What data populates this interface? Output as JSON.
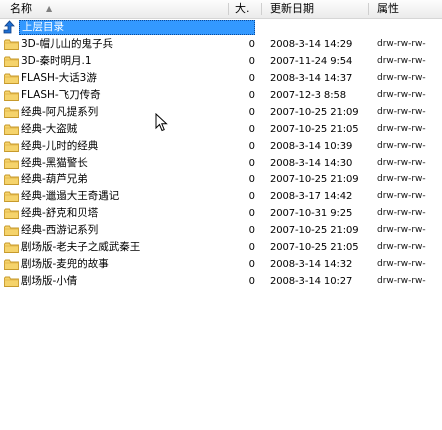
{
  "columns": {
    "name": "名称",
    "size": "大.",
    "date": "更新日期",
    "attr": "属性"
  },
  "parent_row": {
    "label": "上层目录"
  },
  "files": [
    {
      "name": "3D-帽儿山的鬼子兵",
      "size": "0",
      "date": "2008-3-14 14:29",
      "attr": "drw-rw-rw-"
    },
    {
      "name": "3D-秦时明月.1",
      "size": "0",
      "date": "2007-11-24 9:54",
      "attr": "drw-rw-rw-"
    },
    {
      "name": "FLASH-大话3游",
      "size": "0",
      "date": "2008-3-14 14:37",
      "attr": "drw-rw-rw-"
    },
    {
      "name": "FLASH-飞刀传奇",
      "size": "0",
      "date": "2007-12-3 8:58",
      "attr": "drw-rw-rw-"
    },
    {
      "name": "经典-阿凡提系列",
      "size": "0",
      "date": "2007-10-25 21:09",
      "attr": "drw-rw-rw-"
    },
    {
      "name": "经典-大盗贼",
      "size": "0",
      "date": "2007-10-25 21:05",
      "attr": "drw-rw-rw-"
    },
    {
      "name": "经典-儿时的经典",
      "size": "0",
      "date": "2008-3-14 10:39",
      "attr": "drw-rw-rw-"
    },
    {
      "name": "经典-黑猫警长",
      "size": "0",
      "date": "2008-3-14 14:30",
      "attr": "drw-rw-rw-"
    },
    {
      "name": "经典-葫芦兄弟",
      "size": "0",
      "date": "2007-10-25 21:09",
      "attr": "drw-rw-rw-"
    },
    {
      "name": "经典-邋遢大王奇遇记",
      "size": "0",
      "date": "2008-3-17 14:42",
      "attr": "drw-rw-rw-"
    },
    {
      "name": "经典-舒克和贝塔",
      "size": "0",
      "date": "2007-10-31 9:25",
      "attr": "drw-rw-rw-"
    },
    {
      "name": "经典-西游记系列",
      "size": "0",
      "date": "2007-10-25 21:09",
      "attr": "drw-rw-rw-"
    },
    {
      "name": "剧场版-老夫子之威武秦王",
      "size": "0",
      "date": "2007-10-25 21:05",
      "attr": "drw-rw-rw-"
    },
    {
      "name": "剧场版-麦兜的故事",
      "size": "0",
      "date": "2008-3-14 14:32",
      "attr": "drw-rw-rw-"
    },
    {
      "name": "剧场版-小倩",
      "size": "0",
      "date": "2008-3-14 10:27",
      "attr": "drw-rw-rw-"
    }
  ],
  "icons": {
    "folder": "folder-icon",
    "up": "up-folder-icon",
    "sort": "sort-ascending-icon",
    "cursor": "mouse-pointer-icon"
  },
  "colors": {
    "selection": "#3399ff",
    "folder_body": "#f5d36b",
    "folder_edge": "#c79a2b"
  }
}
